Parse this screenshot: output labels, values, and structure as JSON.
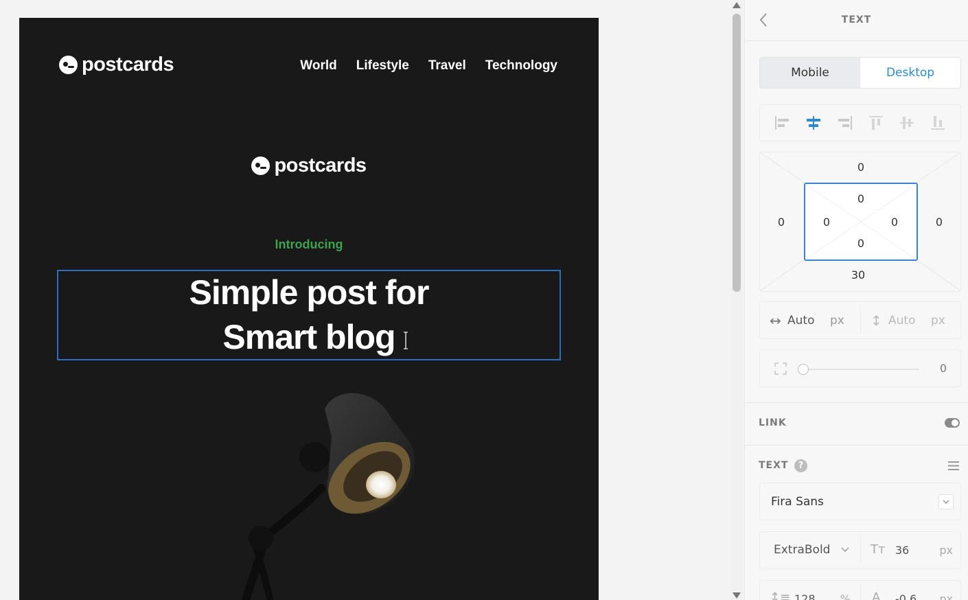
{
  "email": {
    "brand": "postcards",
    "nav": [
      "World",
      "Lifestyle",
      "Travel",
      "Technology"
    ],
    "brand_center": "postcards",
    "intro": "Introducing",
    "headline_line1": "Simple post for",
    "headline_line2": "Smart blog"
  },
  "panel": {
    "title": "TEXT",
    "tabs": {
      "mobile": "Mobile",
      "desktop": "Desktop",
      "active": "Desktop"
    },
    "alignment": {
      "active": "center-horizontal"
    },
    "box": {
      "margin_top": "0",
      "margin_left": "0",
      "margin_right": "0",
      "margin_bottom": "30",
      "padding_top": "0",
      "padding_left": "0",
      "padding_right": "0",
      "padding_bottom": "0"
    },
    "size": {
      "width_value": "Auto",
      "width_unit": "px",
      "height_value": "Auto",
      "height_unit": "px"
    },
    "radius": {
      "value": "0",
      "slider_level": 0
    },
    "link": {
      "label": "LINK",
      "enabled": false
    },
    "text": {
      "label": "TEXT",
      "help": "?",
      "font_family": "Fira Sans",
      "font_weight": "ExtraBold",
      "font_size": "36",
      "font_size_unit": "px",
      "line_height": "128",
      "line_height_unit": "%",
      "letter_spacing": "-0.6",
      "letter_spacing_unit": "px"
    }
  },
  "colors": {
    "accent": "#2a8bd0",
    "intro_green": "#3fa34d",
    "email_bg": "#191919",
    "selection_border": "#2d6fbf"
  }
}
